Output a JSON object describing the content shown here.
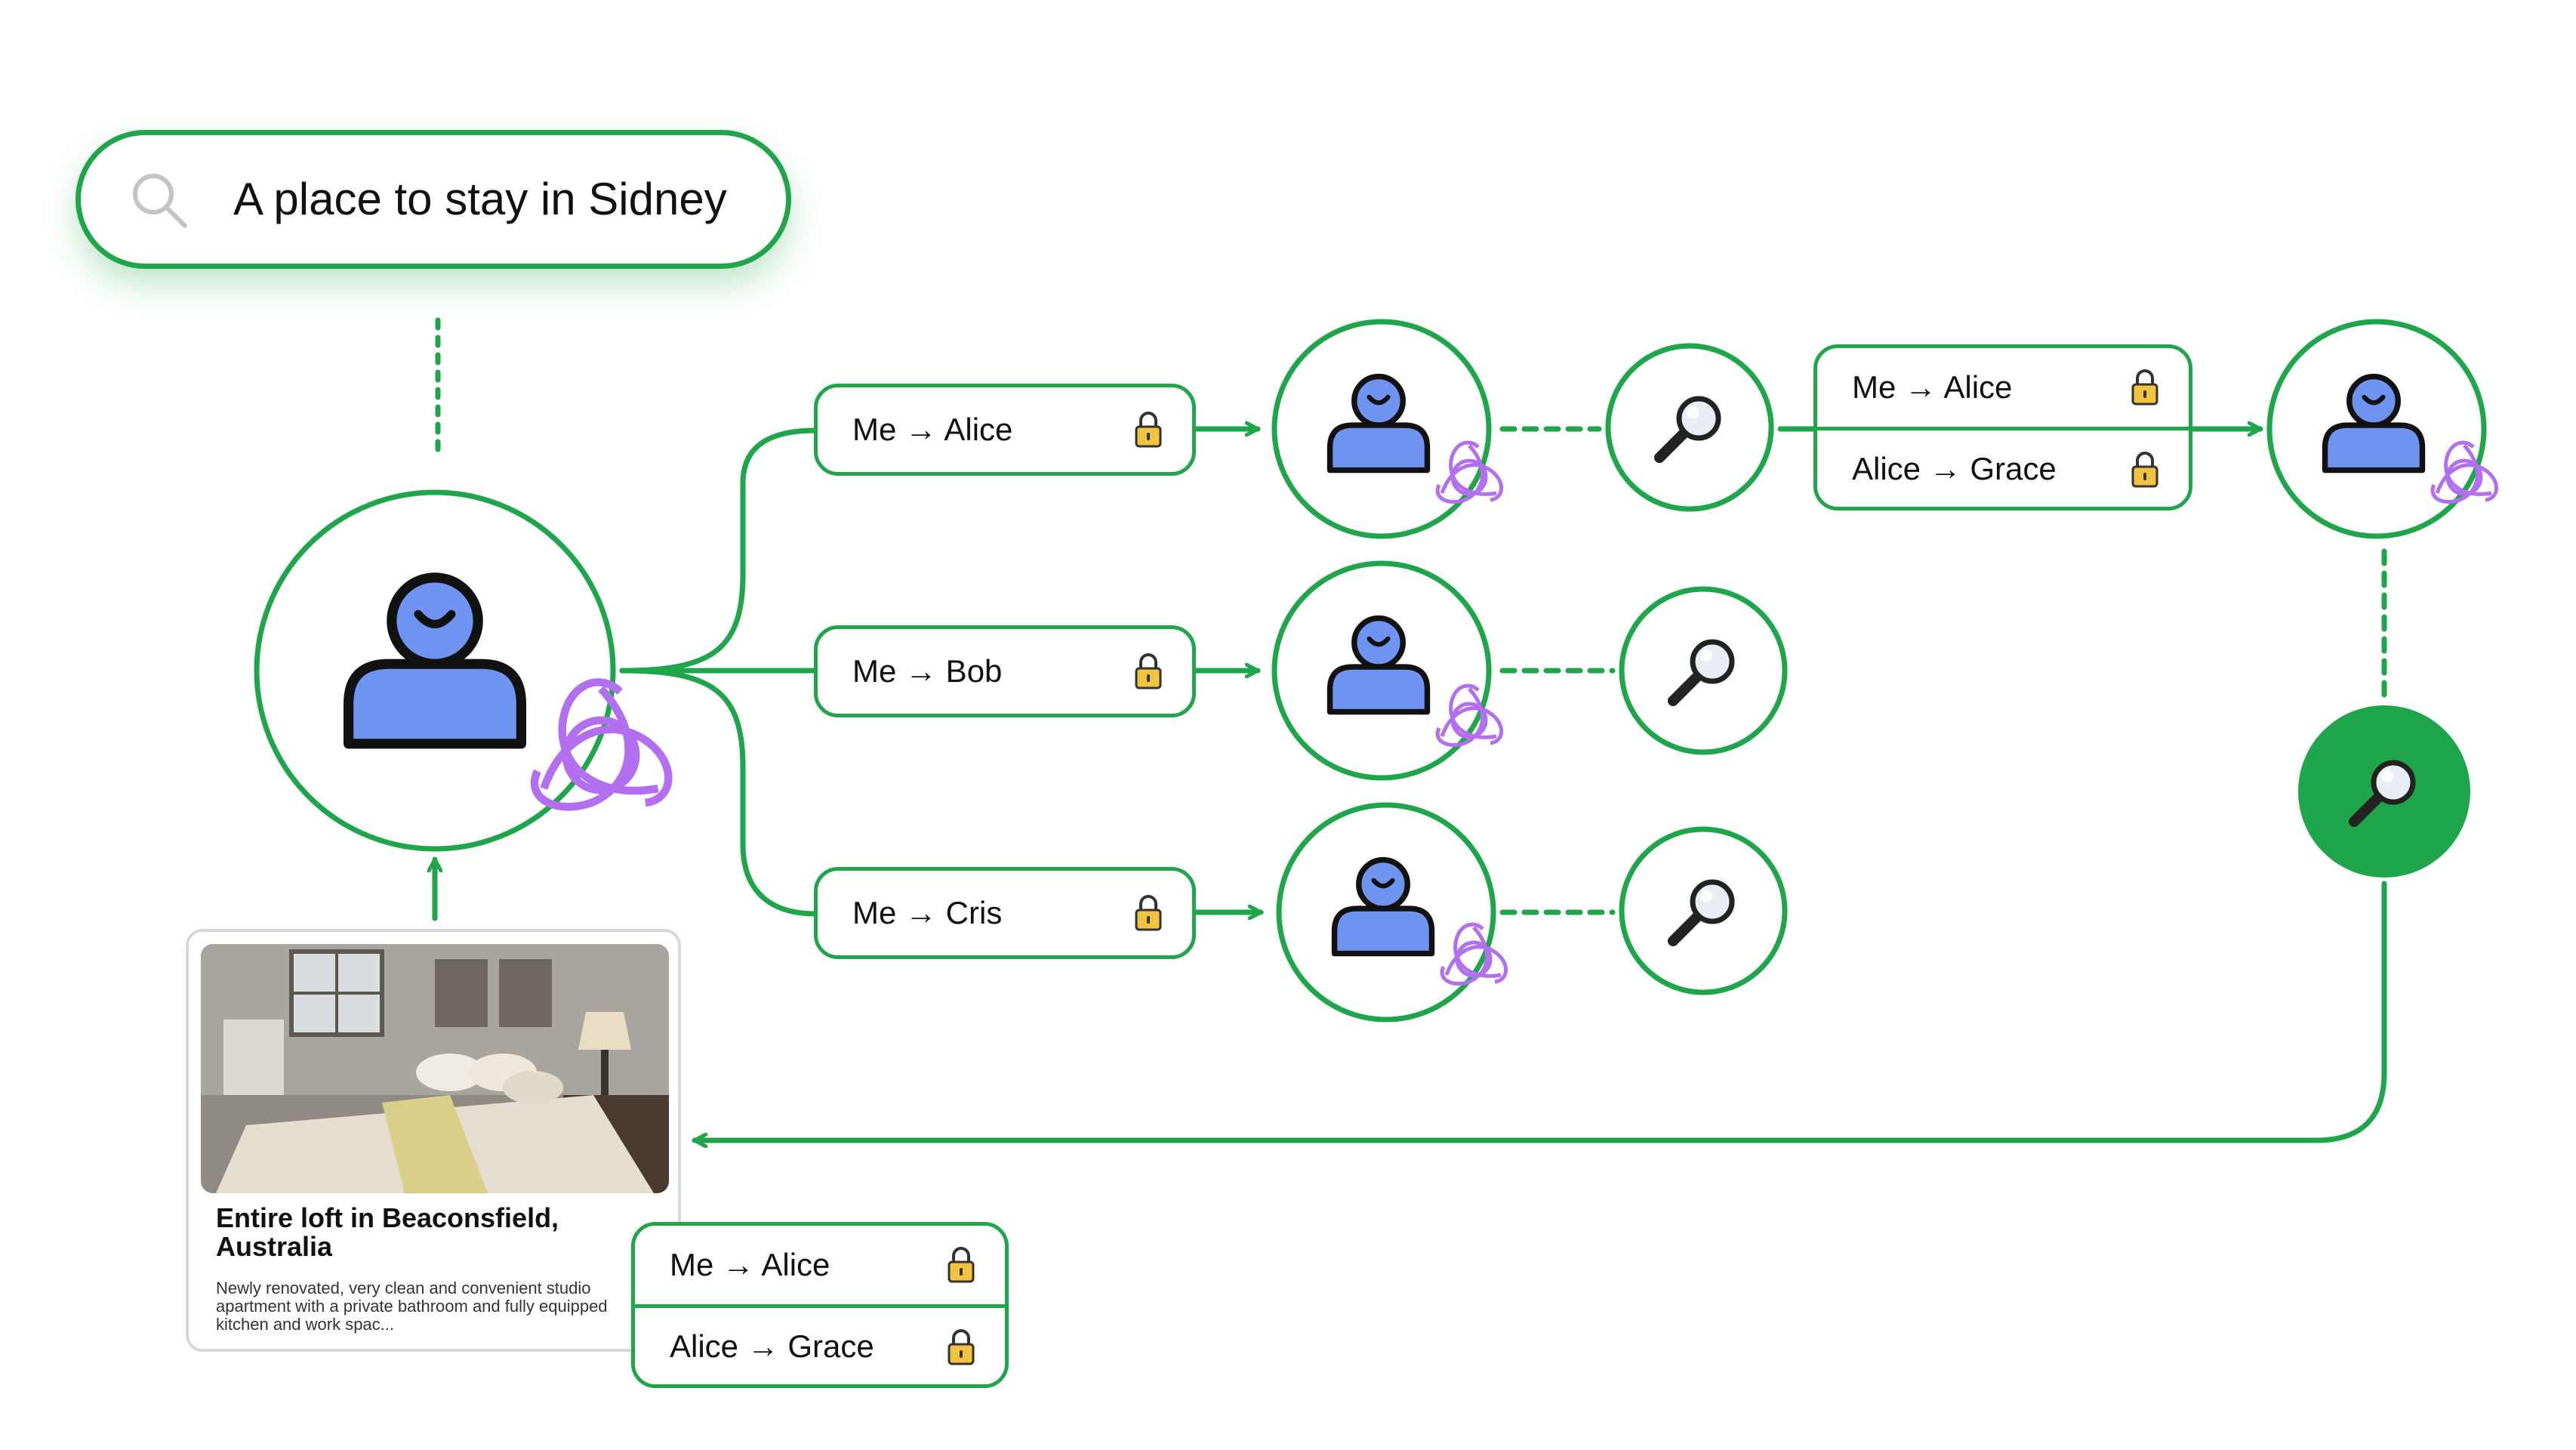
{
  "search": {
    "query": "A place to stay in Sidney"
  },
  "edge_labels": {
    "me_alice": "Me → Alice",
    "me_bob": "Me → Bob",
    "me_cris": "Me → Cris",
    "route_me_alice": "Me → Alice",
    "route_alice_grace": "Alice → Grace",
    "result_me_alice": "Me → Alice",
    "result_alice_grace": "Alice → Grace"
  },
  "listing": {
    "title": "Entire loft in Beaconsfield, Australia",
    "description": "Newly renovated, very clean and convenient studio apartment with a private bathroom and fully equipped kitchen and work spac..."
  },
  "colors": {
    "accent_green": "#1fa64b",
    "person_blue": "#6e93f0",
    "badge_purple": "#b26ff0",
    "lock_gold": "#f2c340"
  },
  "icons": [
    "search-icon",
    "user-icon",
    "triquetra-icon",
    "magnifier-icon",
    "lock-icon"
  ]
}
